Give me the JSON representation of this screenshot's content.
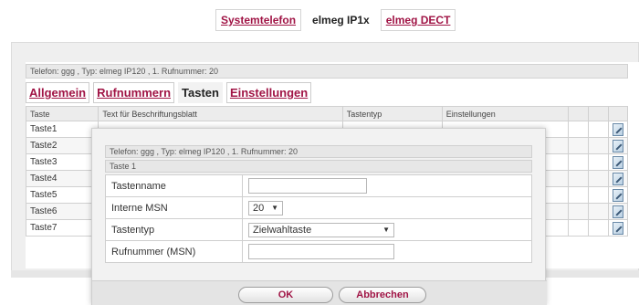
{
  "top_tabs": [
    {
      "label": "Systemtelefon",
      "active": false
    },
    {
      "label": "elmeg IP1x",
      "active": true
    },
    {
      "label": "elmeg DECT",
      "active": false
    }
  ],
  "info_line": "Telefon: ggg , Typ: elmeg IP120 , 1. Rufnummer: 20",
  "sub_tabs": [
    {
      "label": "Allgemein",
      "active": false
    },
    {
      "label": "Rufnummern",
      "active": false
    },
    {
      "label": "Tasten",
      "active": true
    },
    {
      "label": "Einstellungen",
      "active": false
    }
  ],
  "table": {
    "columns": [
      "Taste",
      "Text für Beschriftungsblatt",
      "Tastentyp",
      "Einstellungen",
      "",
      ""
    ],
    "rows": [
      {
        "taste": "Taste1"
      },
      {
        "taste": "Taste2"
      },
      {
        "taste": "Taste3"
      },
      {
        "taste": "Taste4"
      },
      {
        "taste": "Taste5"
      },
      {
        "taste": "Taste6"
      },
      {
        "taste": "Taste7"
      }
    ],
    "edit_icon": "edit-icon"
  },
  "modal": {
    "info_line": "Telefon: ggg , Typ: elmeg IP120 , 1. Rufnummer: 20",
    "key_title": "Taste 1",
    "fields": {
      "tastenname_label": "Tastenname",
      "tastenname_value": "",
      "msn_label": "Interne MSN",
      "msn_value": "20",
      "tastentyp_label": "Tastentyp",
      "tastentyp_value": "Zielwahltaste",
      "rufnummer_label": "Rufnummer (MSN)",
      "rufnummer_value": ""
    },
    "ok_label": "OK",
    "cancel_label": "Abbrechen"
  },
  "colors": {
    "accent": "#a01445",
    "panel_bg": "#efefef"
  }
}
